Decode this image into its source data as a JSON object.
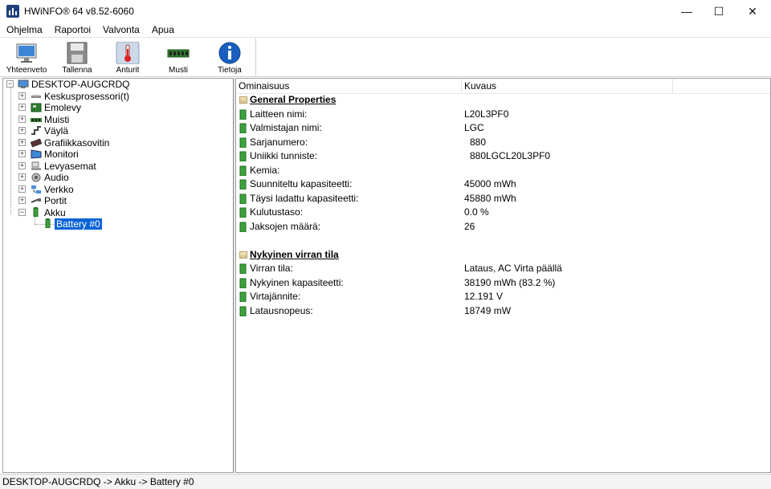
{
  "window": {
    "title": "HWiNFO® 64 v8.52-6060",
    "controls": {
      "minimize": "—",
      "maximize": "☐",
      "close": "✕"
    }
  },
  "menu": [
    "Ohjelma",
    "Raportoi",
    "Valvonta",
    "Apua"
  ],
  "toolbar": [
    {
      "label": "Yhteenveto",
      "icon": "monitor-icon"
    },
    {
      "label": "Tallenna",
      "icon": "floppy-disk-icon"
    },
    {
      "label": "Anturit",
      "icon": "thermometer-icon"
    },
    {
      "label": "Musti",
      "icon": "memory-module-icon"
    },
    {
      "label": "Tietoja",
      "icon": "info-icon"
    }
  ],
  "tree": {
    "root": "DESKTOP-AUGCRDQ",
    "items": [
      {
        "label": "Keskusprosessori(t)",
        "icon": "cpu-icon",
        "expander": "+"
      },
      {
        "label": "Emolevy",
        "icon": "motherboard-icon",
        "expander": "+"
      },
      {
        "label": "Muisti",
        "icon": "memory-icon",
        "expander": "+"
      },
      {
        "label": "Väylä",
        "icon": "bus-icon",
        "expander": "+"
      },
      {
        "label": "Grafiikkasovitin",
        "icon": "graphics-card-icon",
        "expander": "+"
      },
      {
        "label": "Monitori",
        "icon": "monitor-icon",
        "expander": "+"
      },
      {
        "label": "Levyasemat",
        "icon": "drive-icon",
        "expander": "+"
      },
      {
        "label": "Audio",
        "icon": "audio-icon",
        "expander": "+"
      },
      {
        "label": "Verkko",
        "icon": "network-icon",
        "expander": "+"
      },
      {
        "label": "Portit",
        "icon": "ports-icon",
        "expander": "+"
      },
      {
        "label": "Akku",
        "icon": "battery-icon",
        "expander": "−"
      }
    ],
    "child": "Battery #0"
  },
  "details": {
    "columns": [
      "Ominaisuus",
      "Kuvaus"
    ],
    "sections": [
      {
        "title": "General Properties",
        "rows": [
          {
            "prop": "Laitteen nimi:",
            "value": "L20L3PF0",
            "indent": false
          },
          {
            "prop": "Valmistajan nimi:",
            "value": "LGC",
            "indent": false
          },
          {
            "prop": "Sarjanumero:",
            "value": "880",
            "indent": true
          },
          {
            "prop": "Uniikki tunniste:",
            "value": "880LGCL20L3PF0",
            "indent": true
          },
          {
            "prop": "Kemia:",
            "value": "",
            "indent": false
          },
          {
            "prop": "Suunniteltu kapasiteetti:",
            "value": "45000 mWh",
            "indent": false
          },
          {
            "prop": "Täysi ladattu kapasiteetti:",
            "value": "45880 mWh",
            "indent": false
          },
          {
            "prop": "Kulutustaso:",
            "value": "0.0 %",
            "indent": false
          },
          {
            "prop": "Jaksojen määrä:",
            "value": "26",
            "indent": false
          }
        ]
      },
      {
        "title": "Nykyinen virran tila",
        "rows": [
          {
            "prop": "Virran tila:",
            "value": "Lataus, AC Virta päällä",
            "indent": false
          },
          {
            "prop": "Nykyinen kapasiteetti:",
            "value": "38190 mWh (83.2 %)",
            "indent": false
          },
          {
            "prop": "Virtajännite:",
            "value": "12.191 V",
            "indent": false
          },
          {
            "prop": "Latausnopeus:",
            "value": "18749 mW",
            "indent": false
          }
        ]
      }
    ]
  },
  "statusbar": "DESKTOP-AUGCRDQ -> Akku -> Battery #0"
}
